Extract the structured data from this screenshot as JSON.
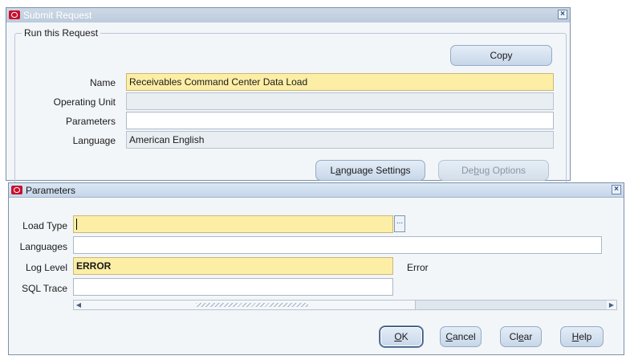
{
  "submit_window": {
    "title": "Submit Request",
    "group_label": "Run this Request",
    "copy_button": "Copy",
    "name_label": "Name",
    "name_value": "Receivables Command Center Data Load",
    "operating_unit_label": "Operating Unit",
    "operating_unit_value": "",
    "parameters_label": "Parameters",
    "parameters_value": "",
    "language_label": "Language",
    "language_value": "American English",
    "language_settings_button": {
      "pre": "L",
      "key": "a",
      "post": "nguage Settings"
    },
    "debug_options_button": {
      "pre": "De",
      "key": "b",
      "post": "ug Options"
    }
  },
  "parameters_window": {
    "title": "Parameters",
    "load_type_label": "Load Type",
    "load_type_value": "",
    "lov_button": "...",
    "languages_label": "Languages",
    "languages_value": "",
    "log_level_label": "Log Level",
    "log_level_value": "ERROR",
    "log_level_description": "Error",
    "sql_trace_label": "SQL Trace",
    "sql_trace_value": "",
    "ok_button": {
      "pre": "",
      "key": "O",
      "post": "K"
    },
    "cancel_button": {
      "pre": "",
      "key": "C",
      "post": "ancel"
    },
    "clear_button": {
      "pre": "Cl",
      "key": "e",
      "post": "ar"
    },
    "help_button": {
      "pre": "",
      "key": "H",
      "post": "elp"
    }
  },
  "icons": {
    "window_logo": "oracle-logo-icon",
    "close": "close-icon",
    "scroll_left": "arrow-left-icon",
    "scroll_right": "arrow-right-icon"
  },
  "colors": {
    "required_field": "#fdeea6",
    "readonly_field": "#e9eef3",
    "titlebar": "#c5d6ea",
    "window_background": "#f3f6f9",
    "logo_red": "#c8102e"
  }
}
